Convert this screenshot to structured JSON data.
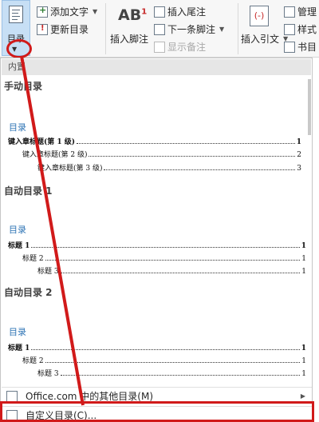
{
  "ribbon": {
    "toc_label": "目录",
    "add_text": "添加文字",
    "update_toc": "更新目录",
    "insert_footnote": "插入脚注",
    "insert_endnote": "插入尾注",
    "next_footnote": "下一条脚注",
    "show_notes": "显示备注",
    "insert_citation": "插入引文",
    "manage": "管理",
    "style": "样式",
    "bibliography": "书目"
  },
  "dropdown": {
    "section_header": "内置",
    "galleries": [
      {
        "title": "手动目录",
        "heading": "目录",
        "lines": [
          {
            "text": "键入章标题(第 1 级)",
            "page": "1",
            "level": 1
          },
          {
            "text": "键入章标题(第 2 级)",
            "page": "2",
            "level": 2
          },
          {
            "text": "键入章标题(第 3 级)",
            "page": "3",
            "level": 3
          }
        ]
      },
      {
        "title": "自动目录 1",
        "heading": "目录",
        "lines": [
          {
            "text": "标题 1",
            "page": "1",
            "level": 1
          },
          {
            "text": "标题 2",
            "page": "1",
            "level": 2
          },
          {
            "text": "标题 3",
            "page": "1",
            "level": 3
          }
        ]
      },
      {
        "title": "自动目录 2",
        "heading": "目录",
        "lines": [
          {
            "text": "标题 1",
            "page": "1",
            "level": 1
          },
          {
            "text": "标题 2",
            "page": "1",
            "level": 2
          },
          {
            "text": "标题 3",
            "page": "1",
            "level": 3
          }
        ]
      }
    ],
    "menu": {
      "more_from_office": "Office.com 中的其他目录(M)",
      "custom_toc": "自定义目录(C)..."
    }
  },
  "annotation_color": "#d11a1a"
}
